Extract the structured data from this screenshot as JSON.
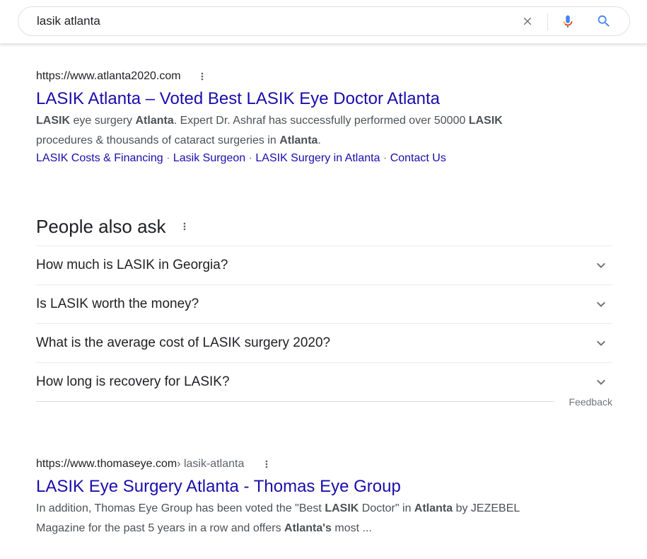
{
  "search": {
    "query": "lasik atlanta"
  },
  "icons": {
    "clear": "close-icon",
    "mic": "microphone-icon",
    "search": "search-icon",
    "more": "more-vert-icon",
    "expand": "chevron-down-icon"
  },
  "colors": {
    "link": "#1a0dab",
    "text": "#202124",
    "snippet": "#4d5156",
    "mic_blue": "#4285f4",
    "mic_red": "#ea4335",
    "mic_yellow": "#fbbc05",
    "mic_green": "#34a853"
  },
  "results": [
    {
      "url": "https://www.atlanta2020.com",
      "path": "",
      "title": "LASIK Atlanta – Voted Best LASIK Eye Doctor Atlanta",
      "snippet": [
        [
          {
            "t": "LASIK",
            "b": true
          },
          {
            "t": " eye surgery ",
            "b": false
          },
          {
            "t": "Atlanta",
            "b": true
          },
          {
            "t": ". Expert Dr. Ashraf has successfully performed over 50000 ",
            "b": false
          },
          {
            "t": "LASIK",
            "b": true
          }
        ],
        [
          {
            "t": "procedures & thousands of cataract surgeries in ",
            "b": false
          },
          {
            "t": "Atlanta",
            "b": true
          },
          {
            "t": ".",
            "b": false
          }
        ]
      ],
      "sitelinks": [
        "LASIK Costs & Financing",
        "Lasik Surgeon",
        "LASIK Surgery in Atlanta",
        "Contact Us"
      ]
    },
    {
      "url": "https://www.thomaseye.com",
      "path": " › lasik-atlanta",
      "title": "LASIK Eye Surgery Atlanta - Thomas Eye Group",
      "snippet": [
        [
          {
            "t": "In addition, Thomas Eye Group has been voted the \"Best ",
            "b": false
          },
          {
            "t": "LASIK",
            "b": true
          },
          {
            "t": " Doctor\" in ",
            "b": false
          },
          {
            "t": "Atlanta",
            "b": true
          },
          {
            "t": " by JEZEBEL",
            "b": false
          }
        ],
        [
          {
            "t": "Magazine for the past 5 years in a row and offers ",
            "b": false
          },
          {
            "t": "Atlanta's",
            "b": true
          },
          {
            "t": " most ...",
            "b": false
          }
        ]
      ],
      "sitelinks": []
    }
  ],
  "people_also_ask": {
    "title": "People also ask",
    "questions": [
      "How much is LASIK in Georgia?",
      "Is LASIK worth the money?",
      "What is the average cost of LASIK surgery 2020?",
      "How long is recovery for LASIK?"
    ],
    "feedback": "Feedback"
  }
}
